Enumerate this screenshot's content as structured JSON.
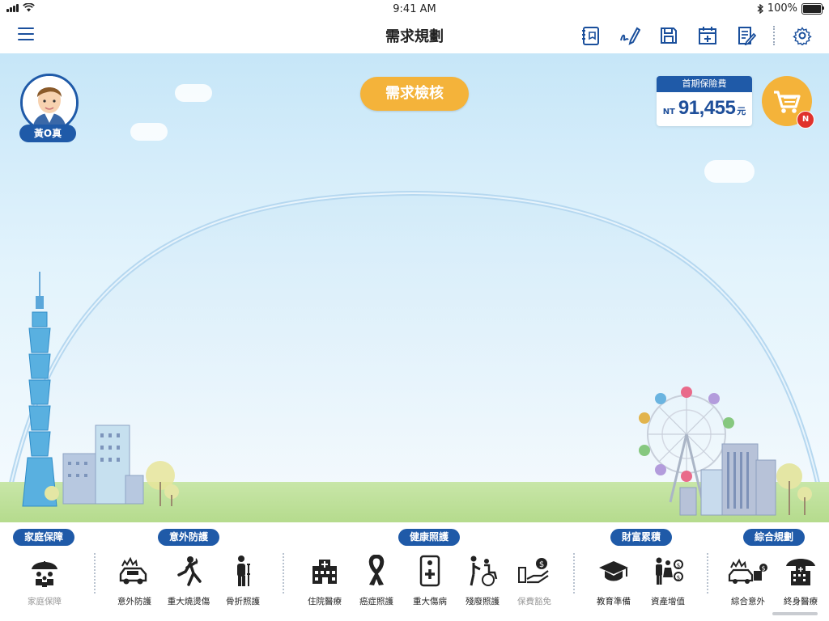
{
  "status_bar": {
    "time": "9:41 AM",
    "battery": "100%"
  },
  "nav": {
    "title": "需求規劃",
    "icons": [
      "notebook-icon",
      "signature-icon",
      "save-icon",
      "calendar-add-icon",
      "edit-document-icon",
      "settings-icon"
    ]
  },
  "client": {
    "name": "黃O真"
  },
  "check_button": "需求檢核",
  "premium": {
    "label": "首期保險費",
    "currency": "NT",
    "amount": "91,455",
    "unit": "元"
  },
  "cart": {
    "badge": "N"
  },
  "categories": [
    {
      "label": "家庭保障"
    },
    {
      "label": "意外防護"
    },
    {
      "label": "健康照護"
    },
    {
      "label": "財富累積"
    },
    {
      "label": "綜合規劃"
    }
  ],
  "items": [
    {
      "label": "家庭保障",
      "dim": true
    },
    {
      "label": "意外防護"
    },
    {
      "label": "重大燒燙傷"
    },
    {
      "label": "骨折照護"
    },
    {
      "label": "住院醫療"
    },
    {
      "label": "癌症照護"
    },
    {
      "label": "重大傷病"
    },
    {
      "label": "殘廢照護"
    },
    {
      "label": "保費豁免",
      "dim": true
    },
    {
      "label": "教育準備"
    },
    {
      "label": "資產增值"
    },
    {
      "label": "綜合意外"
    },
    {
      "label": "終身醫療"
    }
  ],
  "colors": {
    "primary": "#1f5aa8",
    "accent": "#f4b33a",
    "badge": "#e0322c"
  }
}
